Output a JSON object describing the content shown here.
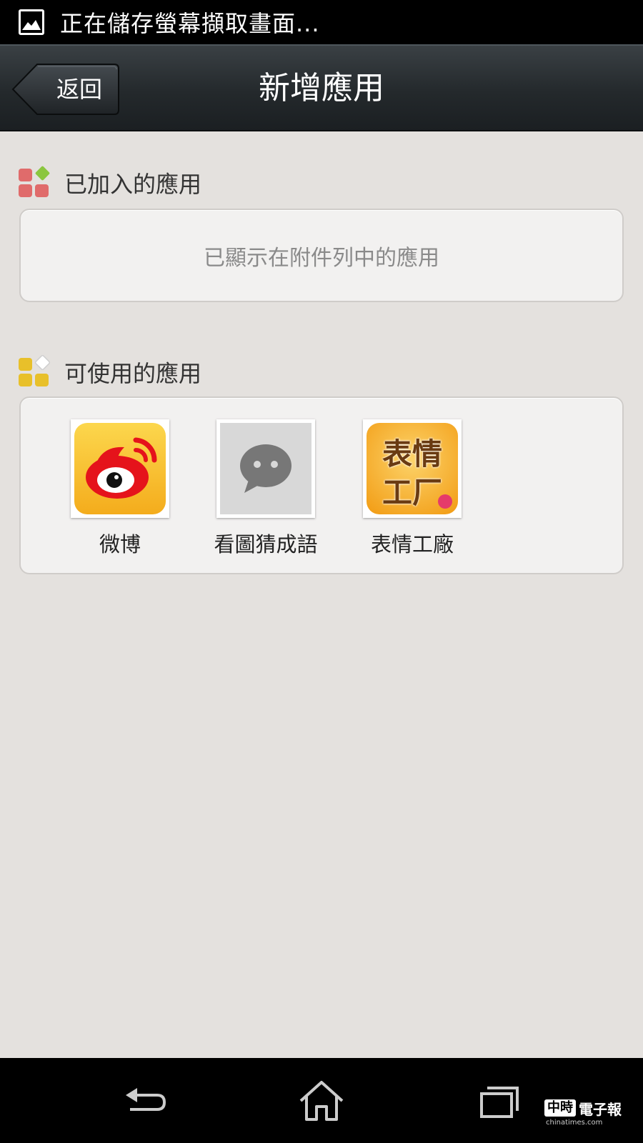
{
  "status_bar": {
    "notification_icon": "image-icon",
    "text": "正在儲存螢幕擷取畫面..."
  },
  "title_bar": {
    "back_label": "返回",
    "title": "新增應用"
  },
  "added_section": {
    "icon": "apps-grid-icon",
    "title": "已加入的應用",
    "empty_text": "已顯示在附件列中的應用"
  },
  "available_section": {
    "icon": "apps-grid-icon",
    "title": "可使用的應用",
    "apps": [
      {
        "label": "微博",
        "icon": "weibo-icon",
        "color": "#f8c23a"
      },
      {
        "label": "看圖猜成語",
        "icon": "chat-bubble-icon",
        "color": "#d8d8d8"
      },
      {
        "label": "表情工廠",
        "icon": "emoji-factory-icon",
        "color": "#f4a317",
        "icon_text_top": "表情",
        "icon_text_bottom": "工厂"
      }
    ]
  },
  "nav_bar": {
    "back": "back-icon",
    "home": "home-icon",
    "recents": "recent-apps-icon"
  },
  "watermark": {
    "badge": "中時",
    "text": "電子報",
    "sub": "chinatimes.com"
  },
  "colors": {
    "background": "#e4e1de",
    "title_bar": "#24292c",
    "panel": "#f2f1f0"
  }
}
